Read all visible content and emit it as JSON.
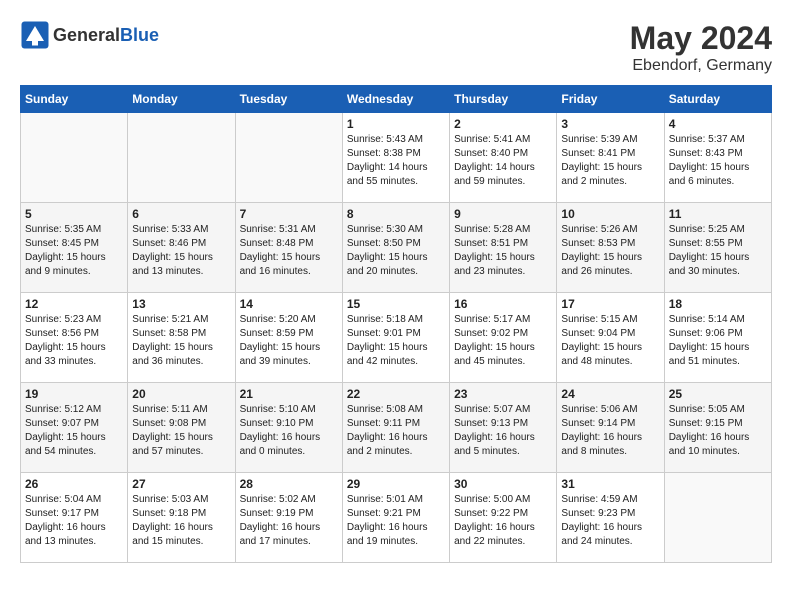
{
  "header": {
    "logo_general": "General",
    "logo_blue": "Blue",
    "title": "May 2024",
    "subtitle": "Ebendorf, Germany"
  },
  "weekdays": [
    "Sunday",
    "Monday",
    "Tuesday",
    "Wednesday",
    "Thursday",
    "Friday",
    "Saturday"
  ],
  "weeks": [
    [
      {
        "day": "",
        "info": ""
      },
      {
        "day": "",
        "info": ""
      },
      {
        "day": "",
        "info": ""
      },
      {
        "day": "1",
        "info": "Sunrise: 5:43 AM\nSunset: 8:38 PM\nDaylight: 14 hours\nand 55 minutes."
      },
      {
        "day": "2",
        "info": "Sunrise: 5:41 AM\nSunset: 8:40 PM\nDaylight: 14 hours\nand 59 minutes."
      },
      {
        "day": "3",
        "info": "Sunrise: 5:39 AM\nSunset: 8:41 PM\nDaylight: 15 hours\nand 2 minutes."
      },
      {
        "day": "4",
        "info": "Sunrise: 5:37 AM\nSunset: 8:43 PM\nDaylight: 15 hours\nand 6 minutes."
      }
    ],
    [
      {
        "day": "5",
        "info": "Sunrise: 5:35 AM\nSunset: 8:45 PM\nDaylight: 15 hours\nand 9 minutes."
      },
      {
        "day": "6",
        "info": "Sunrise: 5:33 AM\nSunset: 8:46 PM\nDaylight: 15 hours\nand 13 minutes."
      },
      {
        "day": "7",
        "info": "Sunrise: 5:31 AM\nSunset: 8:48 PM\nDaylight: 15 hours\nand 16 minutes."
      },
      {
        "day": "8",
        "info": "Sunrise: 5:30 AM\nSunset: 8:50 PM\nDaylight: 15 hours\nand 20 minutes."
      },
      {
        "day": "9",
        "info": "Sunrise: 5:28 AM\nSunset: 8:51 PM\nDaylight: 15 hours\nand 23 minutes."
      },
      {
        "day": "10",
        "info": "Sunrise: 5:26 AM\nSunset: 8:53 PM\nDaylight: 15 hours\nand 26 minutes."
      },
      {
        "day": "11",
        "info": "Sunrise: 5:25 AM\nSunset: 8:55 PM\nDaylight: 15 hours\nand 30 minutes."
      }
    ],
    [
      {
        "day": "12",
        "info": "Sunrise: 5:23 AM\nSunset: 8:56 PM\nDaylight: 15 hours\nand 33 minutes."
      },
      {
        "day": "13",
        "info": "Sunrise: 5:21 AM\nSunset: 8:58 PM\nDaylight: 15 hours\nand 36 minutes."
      },
      {
        "day": "14",
        "info": "Sunrise: 5:20 AM\nSunset: 8:59 PM\nDaylight: 15 hours\nand 39 minutes."
      },
      {
        "day": "15",
        "info": "Sunrise: 5:18 AM\nSunset: 9:01 PM\nDaylight: 15 hours\nand 42 minutes."
      },
      {
        "day": "16",
        "info": "Sunrise: 5:17 AM\nSunset: 9:02 PM\nDaylight: 15 hours\nand 45 minutes."
      },
      {
        "day": "17",
        "info": "Sunrise: 5:15 AM\nSunset: 9:04 PM\nDaylight: 15 hours\nand 48 minutes."
      },
      {
        "day": "18",
        "info": "Sunrise: 5:14 AM\nSunset: 9:06 PM\nDaylight: 15 hours\nand 51 minutes."
      }
    ],
    [
      {
        "day": "19",
        "info": "Sunrise: 5:12 AM\nSunset: 9:07 PM\nDaylight: 15 hours\nand 54 minutes."
      },
      {
        "day": "20",
        "info": "Sunrise: 5:11 AM\nSunset: 9:08 PM\nDaylight: 15 hours\nand 57 minutes."
      },
      {
        "day": "21",
        "info": "Sunrise: 5:10 AM\nSunset: 9:10 PM\nDaylight: 16 hours\nand 0 minutes."
      },
      {
        "day": "22",
        "info": "Sunrise: 5:08 AM\nSunset: 9:11 PM\nDaylight: 16 hours\nand 2 minutes."
      },
      {
        "day": "23",
        "info": "Sunrise: 5:07 AM\nSunset: 9:13 PM\nDaylight: 16 hours\nand 5 minutes."
      },
      {
        "day": "24",
        "info": "Sunrise: 5:06 AM\nSunset: 9:14 PM\nDaylight: 16 hours\nand 8 minutes."
      },
      {
        "day": "25",
        "info": "Sunrise: 5:05 AM\nSunset: 9:15 PM\nDaylight: 16 hours\nand 10 minutes."
      }
    ],
    [
      {
        "day": "26",
        "info": "Sunrise: 5:04 AM\nSunset: 9:17 PM\nDaylight: 16 hours\nand 13 minutes."
      },
      {
        "day": "27",
        "info": "Sunrise: 5:03 AM\nSunset: 9:18 PM\nDaylight: 16 hours\nand 15 minutes."
      },
      {
        "day": "28",
        "info": "Sunrise: 5:02 AM\nSunset: 9:19 PM\nDaylight: 16 hours\nand 17 minutes."
      },
      {
        "day": "29",
        "info": "Sunrise: 5:01 AM\nSunset: 9:21 PM\nDaylight: 16 hours\nand 19 minutes."
      },
      {
        "day": "30",
        "info": "Sunrise: 5:00 AM\nSunset: 9:22 PM\nDaylight: 16 hours\nand 22 minutes."
      },
      {
        "day": "31",
        "info": "Sunrise: 4:59 AM\nSunset: 9:23 PM\nDaylight: 16 hours\nand 24 minutes."
      },
      {
        "day": "",
        "info": ""
      }
    ]
  ]
}
